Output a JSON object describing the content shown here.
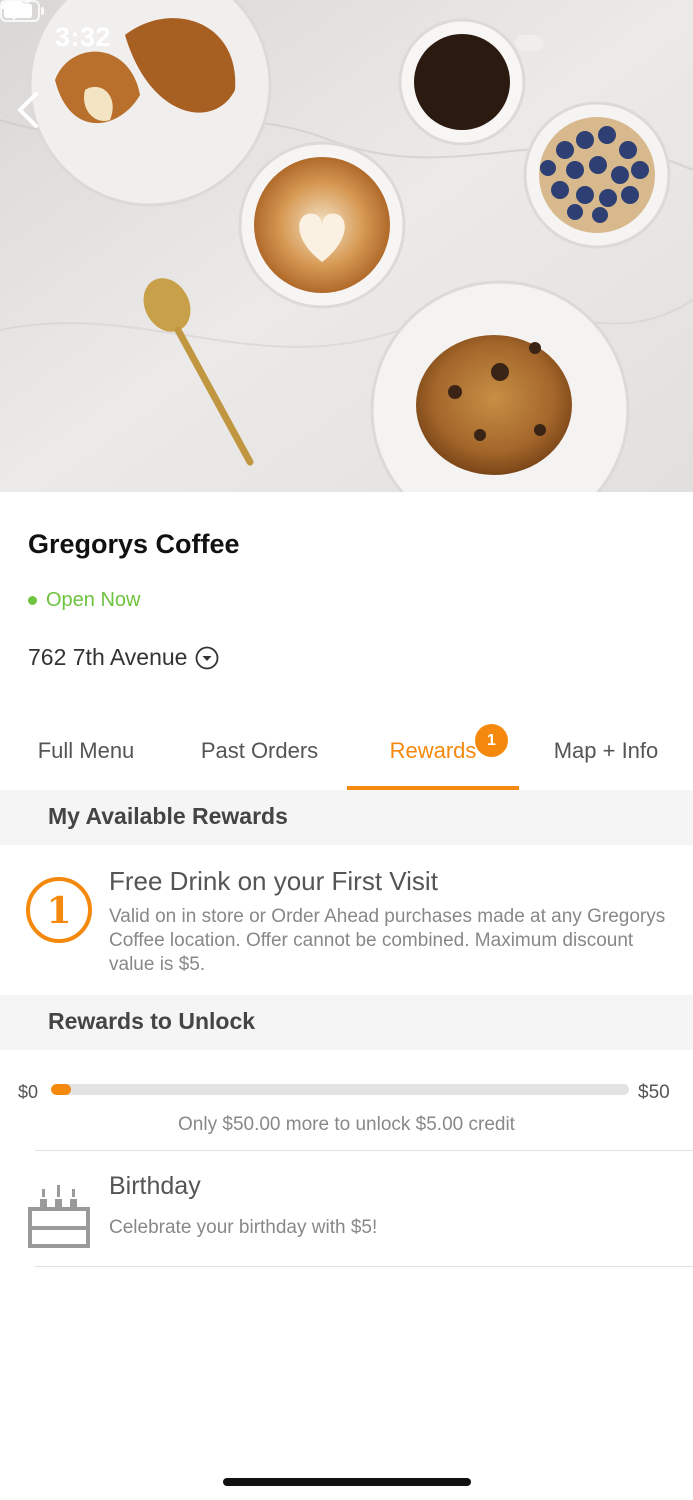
{
  "status_bar": {
    "time": "3:32"
  },
  "store": {
    "name": "Gregorys Coffee",
    "status": "Open Now",
    "address": "762 7th Avenue"
  },
  "tabs": [
    {
      "label": "Full Menu",
      "active": false
    },
    {
      "label": "Past Orders",
      "active": false
    },
    {
      "label": "Rewards",
      "active": true,
      "badge": "1"
    },
    {
      "label": "Map + Info",
      "active": false
    }
  ],
  "available_rewards": {
    "header": "My Available Rewards",
    "items": [
      {
        "icon_number": "1",
        "title": "Free Drink on your First Visit",
        "description": "Valid on in store or Order Ahead purchases made at any Gregorys Coffee location. Offer cannot be combined. Maximum discount value is $5."
      }
    ]
  },
  "rewards_to_unlock": {
    "header": "Rewards to Unlock",
    "progress": {
      "min_label": "$0",
      "max_label": "$50",
      "fraction": 0.035,
      "caption": "Only $50.00 more to unlock $5.00 credit"
    },
    "items": [
      {
        "icon": "birthday-cake-icon",
        "title": "Birthday",
        "description": "Celebrate your birthday with $5!"
      }
    ]
  },
  "colors": {
    "accent": "#f5890d",
    "open_green": "#6fc33f",
    "section_bg": "#f5f5f5"
  }
}
